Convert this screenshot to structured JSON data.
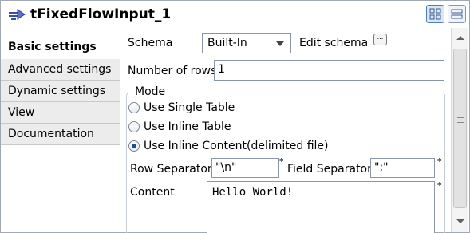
{
  "window": {
    "title": "tFixedFlowInput_1",
    "icon": "flow-arrow-icon"
  },
  "tabs": [
    {
      "label": "Basic settings",
      "active": true
    },
    {
      "label": "Advanced settings",
      "active": false
    },
    {
      "label": "Dynamic settings",
      "active": false
    },
    {
      "label": "View",
      "active": false
    },
    {
      "label": "Documentation",
      "active": false
    }
  ],
  "schema": {
    "label": "Schema",
    "selected": "Built-In",
    "edit_label": "Edit schema",
    "edit_button": "..."
  },
  "rows": {
    "label": "Number of rows",
    "value": "1"
  },
  "mode": {
    "title": "Mode",
    "options": [
      {
        "label": "Use Single Table",
        "checked": false
      },
      {
        "label": "Use Inline Table",
        "checked": false
      },
      {
        "label": "Use Inline Content(delimited file)",
        "checked": true
      }
    ]
  },
  "separators": {
    "row_label": "Row Separator",
    "row_value": "\"\\n\"",
    "field_label": "Field Separator",
    "field_value": "\";\"",
    "required_mark": "*"
  },
  "content": {
    "label": "Content",
    "value": "Hello World!"
  }
}
